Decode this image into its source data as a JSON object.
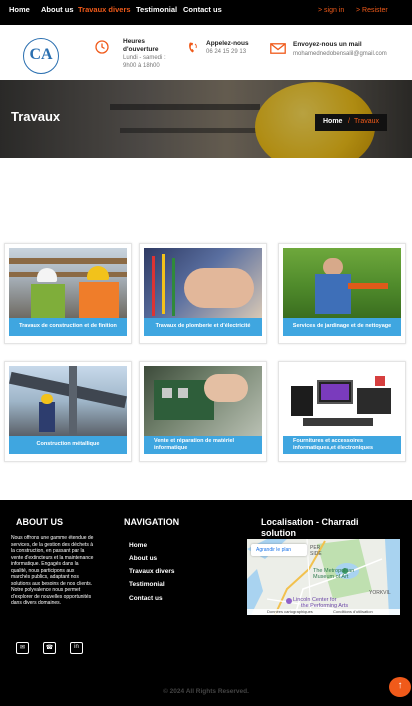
{
  "nav": {
    "links": [
      "Home",
      "About us",
      "Travaux divers",
      "Testimonial",
      "Contact us"
    ],
    "sign_in": "> sign in",
    "register": "> Resister"
  },
  "header": {
    "logo_text": "CA",
    "hours_title_1": "Heures",
    "hours_title_2": "d'ouverture",
    "hours_text_1": "Lundi - samedi :",
    "hours_text_2": "9h00 à 18h00",
    "call_title": "Appelez-nous",
    "call_phone": "06 24 15 29 13",
    "mail_title": "Envoyez-nous un mail",
    "mail_address": "mohamednedobensalil@gmail.com"
  },
  "banner": {
    "title": "Travaux",
    "breadcrumb_home": "Home",
    "breadcrumb_sep": "/",
    "breadcrumb_current": "Travaux"
  },
  "services": [
    {
      "caption": "Travaux de construction et de finition"
    },
    {
      "caption": "Travaux de plomberie et d'électricité"
    },
    {
      "caption": "Services de jardinage et de nettoyage"
    },
    {
      "caption": "Construction métallique"
    },
    {
      "caption_1": "Vente et réparation de matériel",
      "caption_2": "informatique"
    },
    {
      "caption_1": "Fournitures et accessoires",
      "caption_2": "informatiques,et électroniques"
    }
  ],
  "footer": {
    "about_title": "ABOUT US",
    "about_text": "Nous offrons une gamme étendue de services, de la gestion des déchets à la construction, en passant par la vente d'extincteurs et la maintenance informatique. Engagés dans la qualité, nous participons aux marchés publics, adaptant nos solutions aux besoins de nos clients. Notre polyvalence nous permet d'explorer de nouvelles opportunités dans divers domaines.",
    "nav_title": "NAVIGATION",
    "nav_links": [
      "Home",
      "About us",
      "Travaux divers",
      "Testimonial",
      "Contact us"
    ],
    "loc_title_1": "Localisation - Charradi",
    "loc_title_2": "solution",
    "map": {
      "enlarge": "Agrandir le plan",
      "labels": [
        "PER",
        "SIDE",
        "The Metropolitan",
        "Museum of Art",
        "Lincoln Center for",
        "the Performing Arts",
        "YORKVIL"
      ],
      "attr_data": "Données cartographiques",
      "attr_terms": "Conditions d'utilisation"
    },
    "copyright": "© 2024 All Rights Reserved."
  },
  "colors": {
    "accent": "#f05a1a",
    "caption_blue": "#3fa6e0",
    "dark": "#000000"
  }
}
